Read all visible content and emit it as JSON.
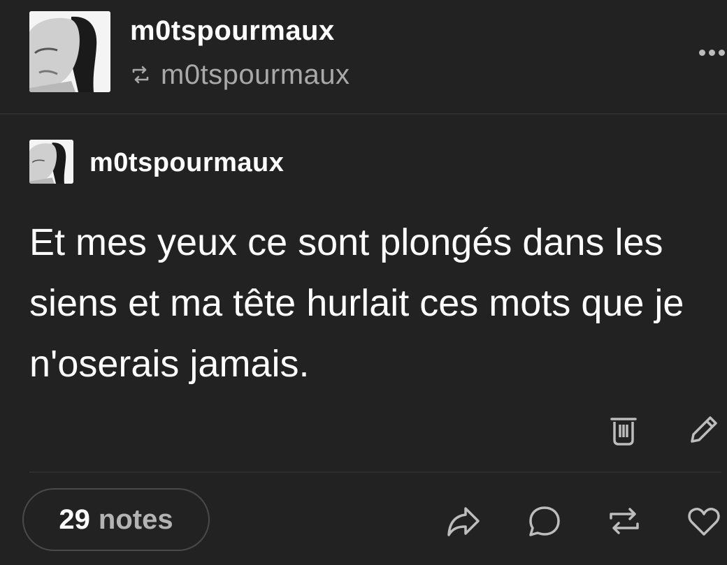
{
  "header": {
    "blog_name": "m0tspourmaux",
    "reblogged_from": "m0tspourmaux",
    "reblog_icon": "reblog-icon",
    "more_icon": "more-dots-icon"
  },
  "post": {
    "author": "m0tspourmaux",
    "text": "Et mes yeux ce sont plongés dans les siens et ma tête hurlait ces mots que je n'oserais jamais."
  },
  "post_actions": {
    "delete_icon": "trash-icon",
    "edit_icon": "pencil-icon"
  },
  "footer": {
    "notes_count": "29",
    "notes_label": "notes",
    "actions": [
      "share-icon",
      "reply-icon",
      "reblog-icon",
      "heart-icon"
    ]
  },
  "colors": {
    "background": "#222222",
    "text": "#ffffff",
    "muted": "#a9a9a9",
    "divider": "#2e2e2e"
  }
}
